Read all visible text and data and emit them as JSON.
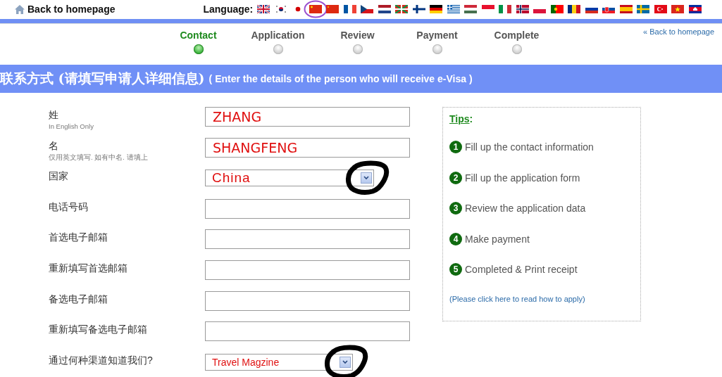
{
  "top_bar": {
    "home_link": "Back to homepage",
    "language_label": "Language:",
    "flags": [
      {
        "kind": "uk",
        "circled": false
      },
      {
        "kind": "kr",
        "circled": false
      },
      {
        "kind": "jp",
        "circled": false
      },
      {
        "kind": "cn",
        "circled": true
      },
      {
        "kind": "hk",
        "circled": false
      },
      {
        "kind": "fr",
        "circled": false
      },
      {
        "kind": "cz",
        "circled": false
      },
      {
        "kind": "nl",
        "circled": false
      },
      {
        "kind": "eus",
        "circled": false
      },
      {
        "kind": "fi",
        "circled": false
      },
      {
        "kind": "de",
        "circled": false
      },
      {
        "kind": "gr",
        "circled": false
      },
      {
        "kind": "hu",
        "circled": false
      },
      {
        "kind": "id",
        "circled": false
      },
      {
        "kind": "it",
        "circled": false
      },
      {
        "kind": "no",
        "circled": false
      },
      {
        "kind": "pl",
        "circled": false
      },
      {
        "kind": "pt",
        "circled": false
      },
      {
        "kind": "ro",
        "circled": false
      },
      {
        "kind": "ru",
        "circled": false
      },
      {
        "kind": "sk",
        "circled": false
      },
      {
        "kind": "es",
        "circled": false
      },
      {
        "kind": "se",
        "circled": false
      },
      {
        "kind": "tr",
        "circled": false
      },
      {
        "kind": "vn",
        "circled": false
      },
      {
        "kind": "kh",
        "circled": false
      }
    ]
  },
  "steps": [
    {
      "label": "Contact",
      "selected": true
    },
    {
      "label": "Application",
      "selected": false
    },
    {
      "label": "Review",
      "selected": false
    },
    {
      "label": "Payment",
      "selected": false
    },
    {
      "label": "Complete",
      "selected": false
    }
  ],
  "back_link": "« Back to homepage",
  "section_header": {
    "title": "联系方式 (请填写申请人详细信息)",
    "subtitle": "( Enter the details of the person who will receive e-Visa )"
  },
  "form_fields": [
    {
      "label": "姓",
      "hint": "In English Only",
      "kind": "text",
      "value": "ZHANG",
      "circled": false
    },
    {
      "label": "名",
      "hint": "仅用英文填写. 如有中名. 请填上",
      "kind": "text",
      "value": "SHANGFENG",
      "circled": false
    },
    {
      "label": "国家",
      "kind": "select",
      "value": "China",
      "circled": true
    },
    {
      "label": "电话号码",
      "kind": "text",
      "circled": false
    },
    {
      "label": "首选电子邮箱",
      "kind": "text",
      "circled": false
    },
    {
      "label": "重新填写首选邮箱",
      "kind": "text",
      "circled": false
    },
    {
      "label": "备选电子邮箱",
      "kind": "text",
      "circled": false
    },
    {
      "label": "重新填写备选电子邮箱",
      "kind": "text",
      "circled": false
    },
    {
      "label": "通过何种渠道知道我们?",
      "kind": "select",
      "value": "Travel Magzine",
      "circled": true
    }
  ],
  "tips": {
    "title": "Tips",
    "title_mark": ":",
    "items": [
      {
        "number": "1",
        "text": "Fill up the contact information"
      },
      {
        "number": "2",
        "text": "Fill up the application form"
      },
      {
        "number": "3",
        "text": "Review the application data"
      },
      {
        "number": "4",
        "text": "Make payment"
      },
      {
        "number": "5",
        "text": "Completed & Print receipt"
      }
    ],
    "link": "(Please click here to read how to apply)"
  }
}
